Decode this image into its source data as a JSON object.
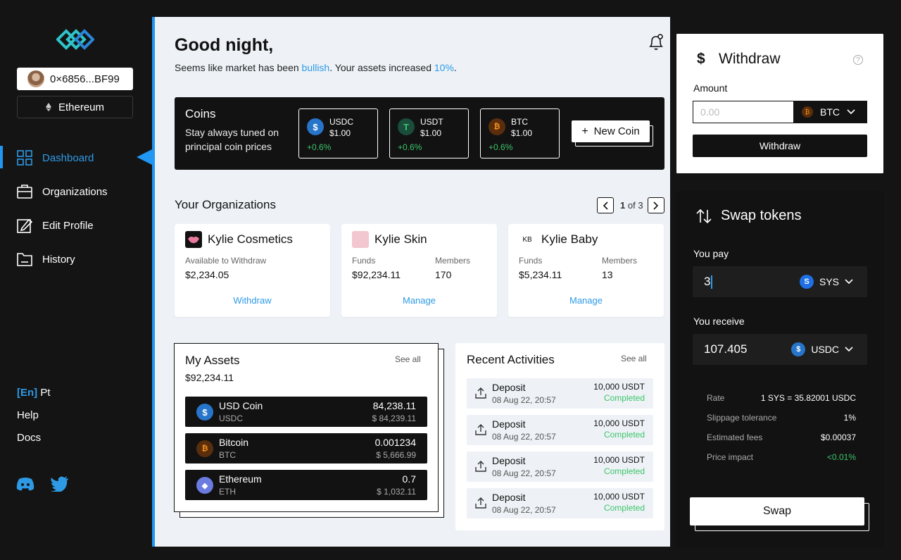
{
  "wallet": {
    "address": "0×6856...BF99",
    "network": "Ethereum"
  },
  "nav": [
    {
      "label": "Dashboard",
      "icon": "dashboard-icon",
      "active": true
    },
    {
      "label": "Organizations",
      "icon": "briefcase-icon"
    },
    {
      "label": "Edit Profile",
      "icon": "edit-icon"
    },
    {
      "label": "History",
      "icon": "folder-icon"
    }
  ],
  "language": {
    "current": "[En]",
    "other": "Pt"
  },
  "links": {
    "help": "Help",
    "docs": "Docs"
  },
  "header": {
    "greeting": "Good night,",
    "subtitle_pre": "Seems like market has been ",
    "subtitle_trend": "bullish",
    "subtitle_mid": ". Your assets increased ",
    "subtitle_pct": "10%",
    "subtitle_post": "."
  },
  "coins": {
    "title": "Coins",
    "description": "Stay always tuned on principal coin prices",
    "items": [
      {
        "symbol": "USDC",
        "price": "$1.00",
        "change": "+0.6%"
      },
      {
        "symbol": "USDT",
        "price": "$1.00",
        "change": "+0.6%"
      },
      {
        "symbol": "BTC",
        "price": "$1.00",
        "change": "+0.6%"
      }
    ],
    "new_coin_label": "New Coin"
  },
  "organizations": {
    "title": "Your Organizations",
    "page_current": "1",
    "page_of": "of 3",
    "items": [
      {
        "name": "Kylie Cosmetics",
        "label1": "Available to Withdraw",
        "value1": "$2,234.05",
        "action": "Withdraw"
      },
      {
        "name": "Kylie Skin",
        "label1": "Funds",
        "value1": "$92,234.11",
        "label2": "Members",
        "value2": "170",
        "action": "Manage"
      },
      {
        "name": "Kylie Baby",
        "logo_text": "KB",
        "label1": "Funds",
        "value1": "$5,234.11",
        "label2": "Members",
        "value2": "13",
        "action": "Manage"
      }
    ]
  },
  "assets": {
    "title": "My Assets",
    "see_all": "See all",
    "total": "$92,234.11",
    "items": [
      {
        "name": "USD Coin",
        "symbol": "USDC",
        "amount": "84,238.11",
        "usd": "$ 84,239.11"
      },
      {
        "name": "Bitcoin",
        "symbol": "BTC",
        "amount": "0.001234",
        "usd": "$ 5,666.99"
      },
      {
        "name": "Ethereum",
        "symbol": "ETH",
        "amount": "0.7",
        "usd": "$ 1,032.11"
      }
    ]
  },
  "activities": {
    "title": "Recent Activities",
    "see_all": "See all",
    "items": [
      {
        "type": "Deposit",
        "date": "08 Aug 22, 20:57",
        "amount": "10,000 USDT",
        "status": "Completed"
      },
      {
        "type": "Deposit",
        "date": "08 Aug 22, 20:57",
        "amount": "10,000 USDT",
        "status": "Completed"
      },
      {
        "type": "Deposit",
        "date": "08 Aug 22, 20:57",
        "amount": "10,000 USDT",
        "status": "Completed"
      },
      {
        "type": "Deposit",
        "date": "08 Aug 22, 20:57",
        "amount": "10,000 USDT",
        "status": "Completed"
      }
    ]
  },
  "withdraw": {
    "title": "Withdraw",
    "amount_label": "Amount",
    "amount_placeholder": "0.00",
    "coin": "BTC",
    "button": "Withdraw"
  },
  "swap": {
    "title": "Swap tokens",
    "pay_label": "You pay",
    "pay_value": "3",
    "pay_coin": "SYS",
    "receive_label": "You receive",
    "receive_value": "107.405",
    "receive_coin": "USDC",
    "info": [
      {
        "label": "Rate",
        "value": "1 SYS = 35.82001 USDC"
      },
      {
        "label": "Slippage tolerance",
        "value": "1%"
      },
      {
        "label": "Estimated fees",
        "value": "$0.00037"
      },
      {
        "label": "Price impact",
        "value": "<0.01%"
      }
    ],
    "button": "Swap"
  },
  "colors": {
    "accent": "#2196f3",
    "link": "#2e9ae6",
    "positive": "#3cc46b",
    "dark": "#121212"
  }
}
